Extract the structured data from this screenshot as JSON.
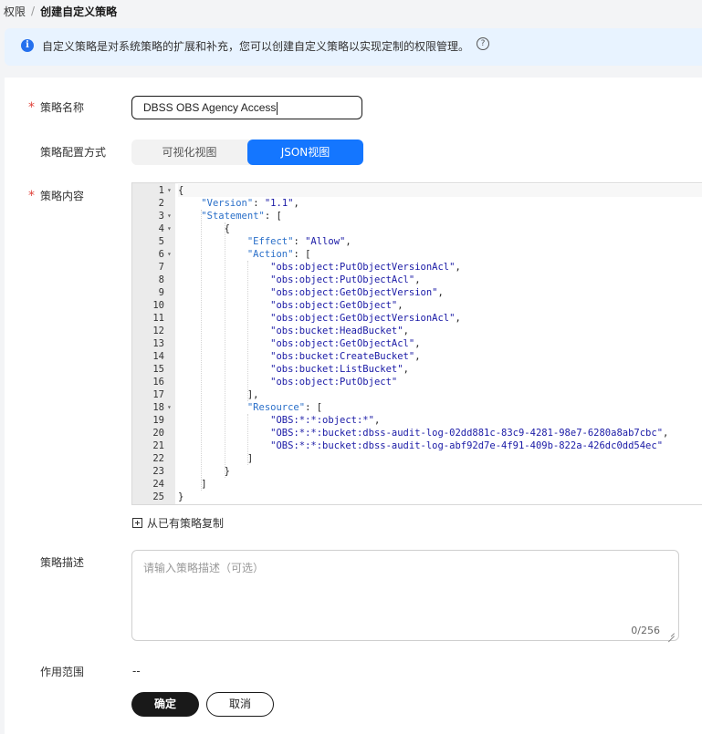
{
  "breadcrumb": {
    "parent": "权限",
    "separator": "/",
    "current": "创建自定义策略"
  },
  "notice": {
    "text": "自定义策略是对系统策略的扩展和补充，您可以创建自定义策略以实现定制的权限管理。",
    "info_icon": "i",
    "help_icon": "?"
  },
  "form": {
    "required_mark": "*",
    "name_label": "策略名称",
    "name_value": "DBSS OBS Agency Access",
    "mode_label": "策略配置方式",
    "mode_options": [
      "可视化视图",
      "JSON视图"
    ],
    "mode_selected": "JSON视图",
    "content_label": "策略内容",
    "copy_label": "从已有策略复制",
    "desc_label": "策略描述",
    "desc_placeholder": "请输入策略描述（可选）",
    "desc_count": "0/256",
    "scope_label": "作用范围",
    "scope_value": "--",
    "confirm_label": "确定",
    "cancel_label": "取消"
  },
  "editor": {
    "line_numbers": [
      "1",
      "2",
      "3",
      "4",
      "5",
      "6",
      "7",
      "8",
      "9",
      "10",
      "11",
      "12",
      "13",
      "14",
      "15",
      "16",
      "17",
      "18",
      "19",
      "20",
      "21",
      "22",
      "23",
      "24",
      "25"
    ],
    "fold_markers": [
      "▾",
      "",
      "▾",
      "▾",
      "",
      "▾",
      "",
      "",
      "",
      "",
      "",
      "",
      "",
      "",
      "",
      "",
      "",
      "▾",
      "",
      "",
      "",
      "",
      "",
      "",
      ""
    ],
    "lines": [
      "{",
      "    \"Version\": \"1.1\",",
      "    \"Statement\": [",
      "        {",
      "            \"Effect\": \"Allow\",",
      "            \"Action\": [",
      "                \"obs:object:PutObjectVersionAcl\",",
      "                \"obs:object:PutObjectAcl\",",
      "                \"obs:object:GetObjectVersion\",",
      "                \"obs:object:GetObject\",",
      "                \"obs:object:GetObjectVersionAcl\",",
      "                \"obs:bucket:HeadBucket\",",
      "                \"obs:object:GetObjectAcl\",",
      "                \"obs:bucket:CreateBucket\",",
      "                \"obs:bucket:ListBucket\",",
      "                \"obs:object:PutObject\"",
      "            ],",
      "            \"Resource\": [",
      "                \"OBS:*:*:object:*\",",
      "                \"OBS:*:*:bucket:dbss-audit-log-02dd881c-83c9-4281-98e7-6280a8ab7cbc\",",
      "                \"OBS:*:*:bucket:dbss-audit-log-abf92d7e-4f91-409b-822a-426dc0dd54ec\"",
      "            ]",
      "        }",
      "    ]",
      "}"
    ]
  },
  "colors": {
    "accent": "#1476ff",
    "required": "#e0433b",
    "notice_bg": "#e8f3ff",
    "json_key": "#2a6fc9",
    "json_string": "#1a1aa6"
  }
}
